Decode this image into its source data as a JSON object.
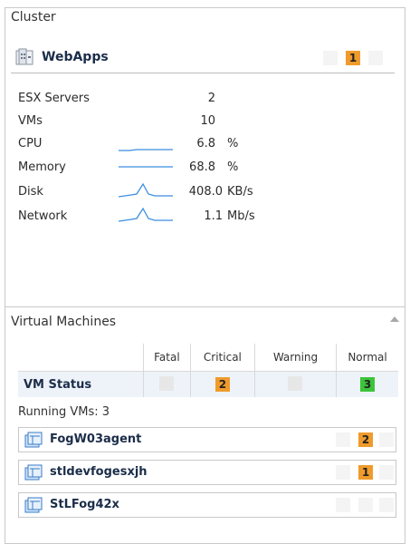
{
  "cluster": {
    "title": "Cluster",
    "name": "WebApps",
    "badge": "1",
    "badge_color": "#ef9b2c",
    "icon": "building-icon",
    "metrics": {
      "esx_label": "ESX Servers",
      "esx_value": "2",
      "vms_label": "VMs",
      "vms_value": "10",
      "cpu_label": "CPU",
      "cpu_value": "6.8",
      "cpu_unit": "%",
      "memory_label": "Memory",
      "memory_value": "68.8",
      "memory_unit": "%",
      "disk_label": "Disk",
      "disk_value": "408.0",
      "disk_unit": "KB/s",
      "network_label": "Network",
      "network_value": "1.1",
      "network_unit": "Mb/s"
    }
  },
  "virtual_machines": {
    "title": "Virtual Machines",
    "columns": [
      "",
      "Fatal",
      "Critical",
      "Warning",
      "Normal"
    ],
    "status_label": "VM Status",
    "status_values": {
      "fatal": "",
      "critical": "2",
      "warning": "",
      "normal": "3"
    },
    "status_colors": {
      "critical": "#ef9b2c",
      "normal": "#3cc43a"
    },
    "running_label": "Running VMs: 3",
    "vms": [
      {
        "name": "FogW03agent",
        "badge": "2"
      },
      {
        "name": "stldevfogesxjh",
        "badge": "1"
      },
      {
        "name": "StLFog42x",
        "badge": ""
      }
    ]
  },
  "accent": "#3b8ee0"
}
